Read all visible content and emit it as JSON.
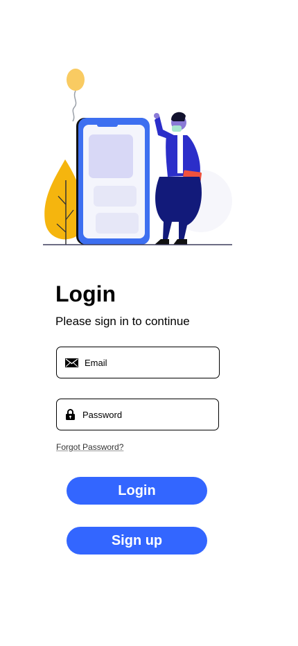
{
  "login": {
    "title": "Login",
    "subtitle": "Please sign in to continue",
    "email_placeholder": "Email",
    "password_placeholder": "Password",
    "forgot_password": "Forgot Password?",
    "login_button": "Login",
    "signup_button": "Sign up"
  },
  "icons": {
    "email": "envelope-icon",
    "password": "lock-icon"
  },
  "colors": {
    "primary": "#3366ff",
    "text": "#000000",
    "background": "#ffffff"
  }
}
